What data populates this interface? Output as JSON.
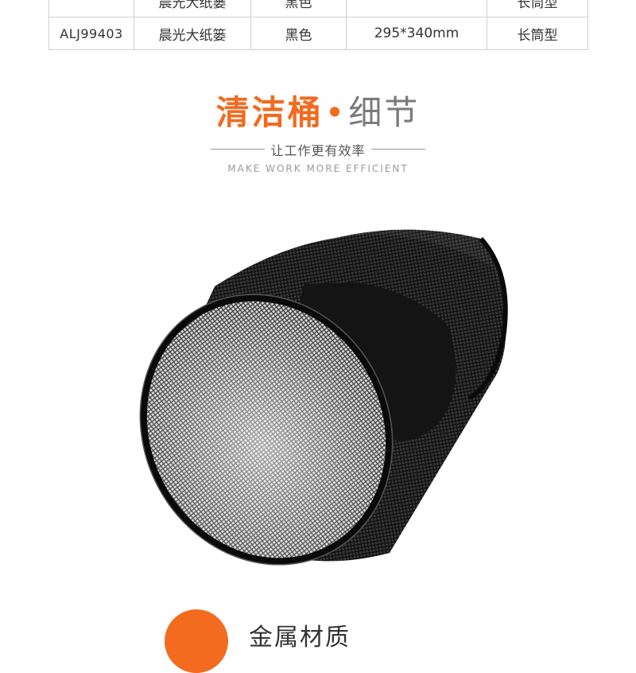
{
  "spec_table": {
    "partial_row": [
      "晨光大纸篓",
      "黑色",
      "",
      "长筒型"
    ],
    "rows": [
      {
        "code": "ALJ99403",
        "name": "晨光大纸篓",
        "color": "黑色",
        "size": "295*340mm",
        "type": "长筒型"
      }
    ]
  },
  "section": {
    "title_main": "清洁桶",
    "title_dot": "•",
    "title_sub": "细节",
    "slogan": "让工作更有效率",
    "slogan_en": "MAKE WORK MORE EFFICIENT"
  },
  "product_image": {
    "icon": "mesh-wastebasket-icon"
  },
  "feature": {
    "label": "金属材质",
    "icon": "feather-icon"
  },
  "colors": {
    "accent": "#f26b1f",
    "border": "#cfcfcf",
    "text": "#333333",
    "mesh": "#1a1a1a"
  }
}
